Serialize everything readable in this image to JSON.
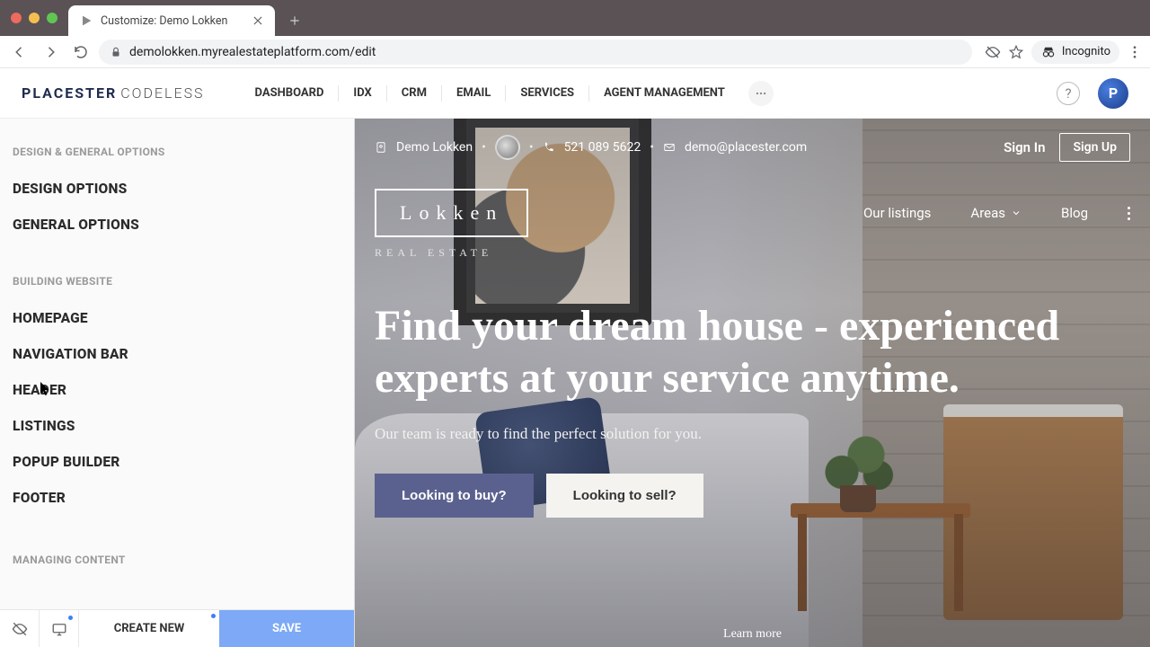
{
  "browser": {
    "tab_title": "Customize: Demo Lokken",
    "url": "demolokken.myrealestateplatform.com/edit",
    "incognito_label": "Incognito"
  },
  "app_nav": {
    "brand_main": "PLACESTER",
    "brand_sub": "CODELESS",
    "items": [
      "DASHBOARD",
      "IDX",
      "CRM",
      "EMAIL",
      "SERVICES",
      "AGENT MANAGEMENT"
    ]
  },
  "sidebar": {
    "section1": "DESIGN & GENERAL OPTIONS",
    "design_options": "DESIGN OPTIONS",
    "general_options": "GENERAL OPTIONS",
    "section2": "BUILDING WEBSITE",
    "homepage": "HOMEPAGE",
    "navigation_bar": "NAVIGATION BAR",
    "header": "HEADER",
    "listings": "LISTINGS",
    "popup_builder": "POPUP BUILDER",
    "footer": "FOOTER",
    "section3": "MANAGING CONTENT",
    "footer_actions": {
      "create_new": "CREATE NEW",
      "save": "SAVE"
    }
  },
  "preview": {
    "agent_name": "Demo Lokken",
    "phone": "521 089 5622",
    "email": "demo@placester.com",
    "sign_in": "Sign In",
    "sign_up": "Sign Up",
    "logo_text": "Lokken",
    "logo_sub": "REAL ESTATE",
    "nav": {
      "listings": "Our listings",
      "areas": "Areas",
      "blog": "Blog"
    },
    "headline": "Find your dream house - experienced experts at your service anytime.",
    "subhead": "Our team is ready to find the perfect solution for you.",
    "cta_buy": "Looking to buy?",
    "cta_sell": "Looking to sell?",
    "learn_more": "Learn more"
  }
}
